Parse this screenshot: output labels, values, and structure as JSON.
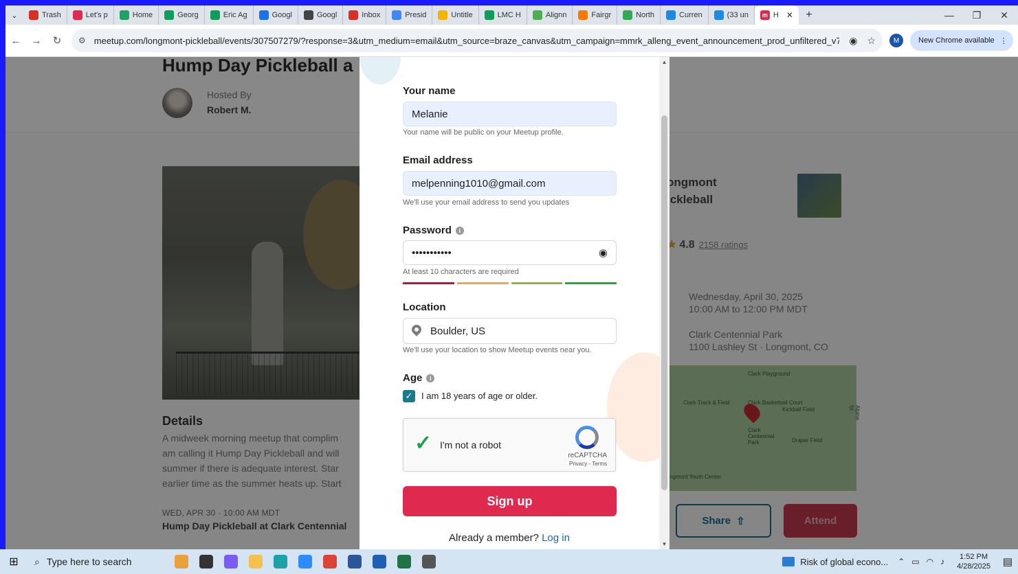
{
  "browser": {
    "tabs": [
      {
        "label": "Trash",
        "icon": "gmail-icon",
        "color": "#d93025"
      },
      {
        "label": "Let's p",
        "icon": "meetup-icon",
        "color": "#e0294e"
      },
      {
        "label": "Home",
        "icon": "drive-icon",
        "color": "#1ea362"
      },
      {
        "label": "Georg",
        "icon": "sheets-icon",
        "color": "#0f9d58"
      },
      {
        "label": "Eric Ag",
        "icon": "sheets-icon",
        "color": "#0f9d58"
      },
      {
        "label": "Googl",
        "icon": "calendar-icon",
        "color": "#1a73e8"
      },
      {
        "label": "Googl",
        "icon": "chrome-icon",
        "color": "#444444"
      },
      {
        "label": "Inbox",
        "icon": "gmail-icon",
        "color": "#d93025"
      },
      {
        "label": "Presid",
        "icon": "docs-icon",
        "color": "#4285f4"
      },
      {
        "label": "Untitle",
        "icon": "slides-icon",
        "color": "#f4b400"
      },
      {
        "label": "LMC H",
        "icon": "sheets-icon",
        "color": "#0f9d58"
      },
      {
        "label": "Alignn",
        "icon": "align-icon",
        "color": "#4caf50"
      },
      {
        "label": "Fairgr",
        "icon": "fairground-icon",
        "color": "#f57c00"
      },
      {
        "label": "North",
        "icon": "maps-icon",
        "color": "#34a853"
      },
      {
        "label": "Curren",
        "icon": "globe-icon",
        "color": "#1e88e5"
      },
      {
        "label": "(33 un",
        "icon": "globe-icon",
        "color": "#1e88e5"
      }
    ],
    "active_tab": {
      "label": "H",
      "icon": "meetup-icon",
      "color": "#e0294e"
    },
    "new_tab": "+",
    "url": "meetup.com/longmont-pickleball/events/307507279/?response=3&utm_medium=email&utm_source=braze_canvas&utm_campaign=mmrk_alleng_event_announcement_prod_unfiltered_v7_...",
    "profile_initial": "M",
    "update_label": "New Chrome available"
  },
  "event": {
    "title": "Hump Day Pickleball a",
    "hosted_by_label": "Hosted By",
    "host_name": "Robert M.",
    "details_title": "Details",
    "details_lines": [
      "A midweek morning meetup that complim",
      "am calling it Hump Day Pickleball and will",
      "summer if there is adequate interest. Star",
      "earlier time as the summer heats up. Start"
    ],
    "date_line": "WED, APR 30 · 10:00 AM MDT",
    "link_line": "Hump Day Pickleball at Clark Centennial",
    "group_name_line1": "ongmont",
    "group_name_line2": "ickleball",
    "rating_value": "4.8",
    "rating_count": "2158 ratings",
    "when_line1": "Wednesday, April 30, 2025",
    "when_line2": "10:00 AM to 12:00 PM MDT",
    "where_line1": "Clark Centennial Park",
    "where_line2": "1100 Lashley St · Longmont, CO",
    "map_labels": [
      "Clark Playground",
      "Clark Track & Field",
      "Clark Basketball Court",
      "Kickball Field",
      "Clark Centennial Park",
      "Draper Field",
      "Alpine St",
      "ngmont Youth Center"
    ],
    "share_label": "Share",
    "attend_label": "Attend"
  },
  "form": {
    "name_label": "Your name",
    "name_value": "Melanie",
    "name_help": "Your name will be public on your Meetup profile.",
    "email_label": "Email address",
    "email_value": "melpenning1010@gmail.com",
    "email_help": "We'll use your email address to send you updates",
    "password_label": "Password",
    "password_value": "•••••••••••",
    "password_help": "At least 10 characters are required",
    "strength_colors": [
      "#c8102e",
      "#f0a84a",
      "#8db83a",
      "#1faa3c"
    ],
    "location_label": "Location",
    "location_value": "Boulder, US",
    "location_help": "We'll use your location to show Meetup events near you.",
    "age_label": "Age",
    "age_checkbox_label": "I am 18 years of age or older.",
    "age_checked": true,
    "captcha_label": "I'm not a robot",
    "captcha_brand": "reCAPTCHA",
    "captcha_terms": "Privacy - Terms",
    "signup_label": "Sign up",
    "already_member": "Already a member?",
    "login_label": "Log in"
  },
  "taskbar": {
    "search_placeholder": "Type here to search",
    "news_text": "Risk of global econo...",
    "time": "1:52 PM",
    "date": "4/28/2025",
    "apps": [
      {
        "name": "gift-app-icon",
        "color": "#e9a23b"
      },
      {
        "name": "task-view-icon",
        "color": "#333333"
      },
      {
        "name": "copilot-icon",
        "color": "#7b5cf0"
      },
      {
        "name": "file-explorer-icon",
        "color": "#f2c14e"
      },
      {
        "name": "edge-icon",
        "color": "#1ba1a8"
      },
      {
        "name": "zoom-icon",
        "color": "#2d8cff"
      },
      {
        "name": "chrome-icon",
        "color": "#db4437"
      },
      {
        "name": "word-icon",
        "color": "#2b579a"
      },
      {
        "name": "whiteboard-icon",
        "color": "#1e5fb4"
      },
      {
        "name": "excel-icon",
        "color": "#217346"
      },
      {
        "name": "calculator-icon",
        "color": "#555555"
      }
    ]
  }
}
